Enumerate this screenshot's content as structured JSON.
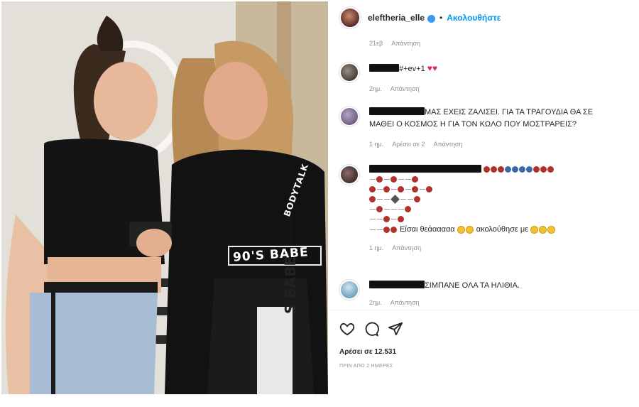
{
  "header": {
    "username": "eleftheria_elle",
    "follow_label": "Ακολουθήστε",
    "dot": "•"
  },
  "top_meta": {
    "time": "21εβ",
    "reply": "Απάντηση"
  },
  "comments": [
    {
      "text_suffix": "#+ev+1",
      "meta": {
        "time": "2ημ.",
        "reply": "Απάντηση"
      }
    },
    {
      "text_line1": "ΜΑΣ ΕΧΕΙΣ ΖΑΛΙΣΕΙ. ΓΙΑ ΤΑ ΤΡΑΓΟΥΔΙΑ ΘΑ ΣΕ",
      "text_line2": "ΜΑΘΕΙ Ο ΚΟΣΜΟΣ Η ΓΙΑ ΤΟΝ ΚΩΛΟ ΠΟΥ ΜΟΣΤΡΑΡΕΙΣ?",
      "meta": {
        "time": "1 ημ.",
        "likes": "Αρέσει σε 2",
        "reply": "Απάντηση"
      }
    },
    {
      "text_tail": "Είσαι θεάααααα",
      "text_follow": "ακολούθησε με",
      "meta": {
        "time": "1 ημ.",
        "reply": "Απάντηση"
      }
    },
    {
      "text": "ΣΙΜΠΑΝΕ ΟΛΑ ΤΑ ΗΛΙΘΙΑ.",
      "meta": {
        "time": "2ημ.",
        "reply": "Απάντηση"
      }
    }
  ],
  "footer": {
    "likes": "Αρέσει σε 12.531",
    "date": "ΠΡΙΝ ΑΠΟ 2 ΗΜΕΡΕΣ"
  },
  "photo": {
    "shirt_text_left": "90'S BABE",
    "shirt_text_sleeve": "BODYTALK",
    "pants_text": "S BABE"
  },
  "icons": {
    "like": "heart-icon",
    "comment": "comment-icon",
    "share": "share-icon",
    "verified": "verified-badge-icon"
  },
  "colors": {
    "link_blue": "#0095f6",
    "heart_red": "#e0245e",
    "meta_grey": "#8e8e8e"
  }
}
